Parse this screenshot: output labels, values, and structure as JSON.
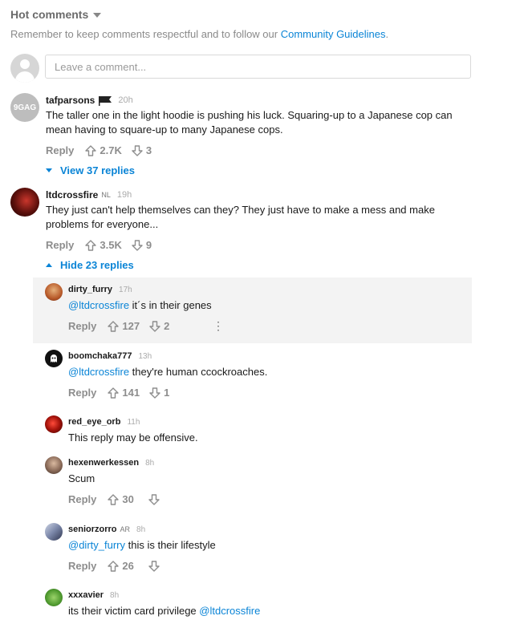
{
  "header": {
    "title": "Hot comments",
    "guidelines_prefix": "Remember to keep comments respectful and to follow our ",
    "guidelines_link": "Community Guidelines",
    "guidelines_suffix": "."
  },
  "input": {
    "placeholder": "Leave a comment..."
  },
  "comments": [
    {
      "user": "tafparsons",
      "country": "",
      "time": "20h",
      "avatar_text": "9GAG",
      "text": "The taller one in the light hoodie is pushing his luck. Squaring-up to a Japanese cop can mean having to square-up to many Japanese cops.",
      "reply": "Reply",
      "up": "2.7K",
      "down": "3",
      "toggle": "View 37 replies"
    },
    {
      "user": "ltdcrossfire",
      "country": "NL",
      "time": "19h",
      "text": "They just can't help themselves can they? They just have to make a mess and make problems for everyone...",
      "reply": "Reply",
      "up": "3.5K",
      "down": "9",
      "toggle": "Hide 23 replies"
    }
  ],
  "replies": [
    {
      "user": "dirty_furry",
      "country": "",
      "time": "17h",
      "mention": "@ltdcrossfire",
      "text": " it´s in their genes",
      "reply": "Reply",
      "up": "127",
      "down": "2",
      "more": "⋮"
    },
    {
      "user": "boomchaka777",
      "country": "",
      "time": "13h",
      "mention": "@ltdcrossfire",
      "text": " they're human ccockroaches.",
      "reply": "Reply",
      "up": "141",
      "down": "1"
    },
    {
      "user": "red_eye_orb",
      "country": "",
      "time": "11h",
      "text": "This reply may be offensive."
    },
    {
      "user": "hexenwerkessen",
      "country": "",
      "time": "8h",
      "text": "Scum",
      "reply": "Reply",
      "up": "30",
      "down": ""
    },
    {
      "user": "seniorzorro",
      "country": "AR",
      "time": "8h",
      "mention": "@dirty_furry",
      "text": " this is their lifestyle",
      "reply": "Reply",
      "up": "26",
      "down": ""
    },
    {
      "user": "xxxavier",
      "country": "",
      "time": "8h",
      "mention_after": "@ltdcrossfire",
      "text": "its their victim card privilege "
    }
  ],
  "colors": {
    "link": "#0a84d6",
    "muted": "#8d8d8d",
    "highlight_bg": "#f3f3f3"
  },
  "icons": {
    "flag": "flag-icon",
    "upvote": "arrow-up-icon",
    "downvote": "arrow-down-icon"
  }
}
